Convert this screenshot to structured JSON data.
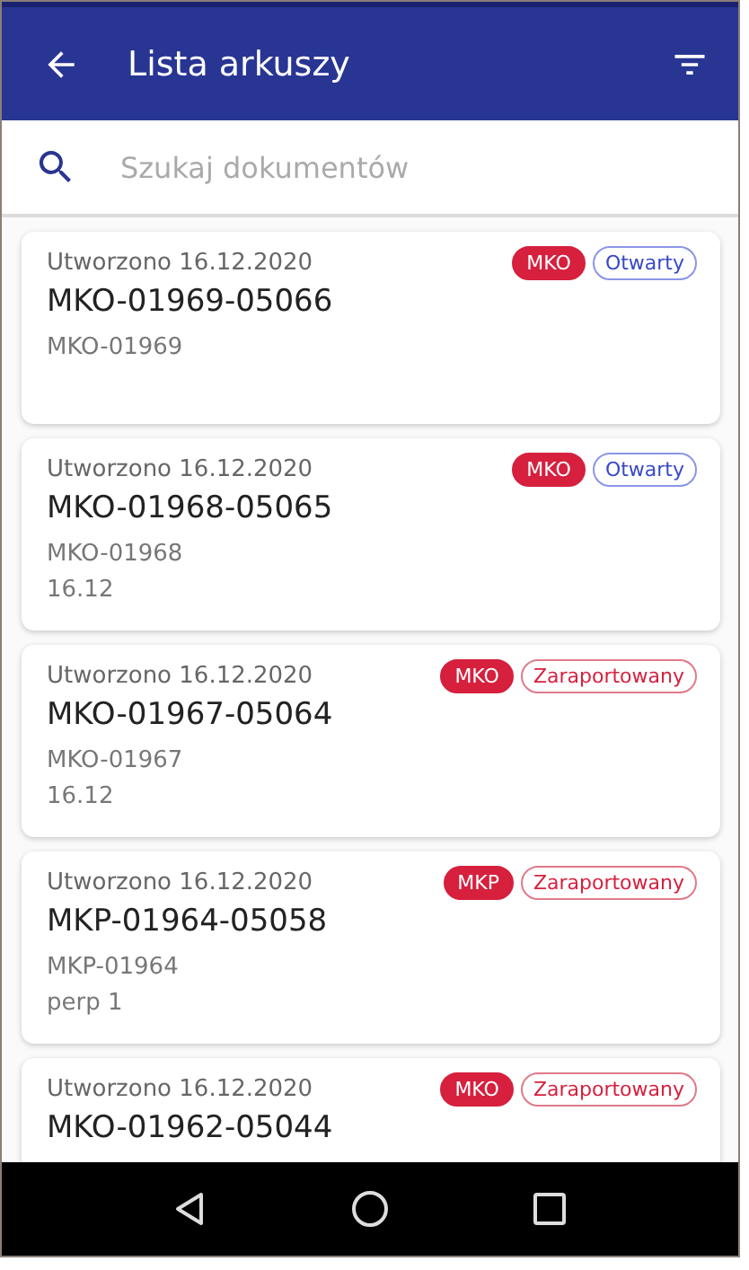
{
  "app_bar": {
    "title": "Lista arkuszy"
  },
  "search": {
    "placeholder": "Szukaj dokumentów"
  },
  "documents": [
    {
      "created": "Utworzono 16.12.2020",
      "number": "MKO-01969-05066",
      "type_tag": "MKO",
      "status": {
        "label": "Otwarty",
        "kind": "open"
      },
      "lines": [
        "MKO-01969"
      ]
    },
    {
      "created": "Utworzono 16.12.2020",
      "number": "MKO-01968-05065",
      "type_tag": "MKO",
      "status": {
        "label": "Otwarty",
        "kind": "open"
      },
      "lines": [
        "MKO-01968",
        "16.12"
      ]
    },
    {
      "created": "Utworzono 16.12.2020",
      "number": "MKO-01967-05064",
      "type_tag": "MKO",
      "status": {
        "label": "Zaraportowany",
        "kind": "reported"
      },
      "lines": [
        "MKO-01967",
        "16.12"
      ]
    },
    {
      "created": "Utworzono 16.12.2020",
      "number": "MKP-01964-05058",
      "type_tag": "MKP",
      "status": {
        "label": "Zaraportowany",
        "kind": "reported"
      },
      "lines": [
        "MKP-01964",
        "perp 1"
      ]
    },
    {
      "created": "Utworzono 16.12.2020",
      "number": "MKO-01962-05044",
      "type_tag": "MKO",
      "status": {
        "label": "Zaraportowany",
        "kind": "reported"
      }
    }
  ]
}
